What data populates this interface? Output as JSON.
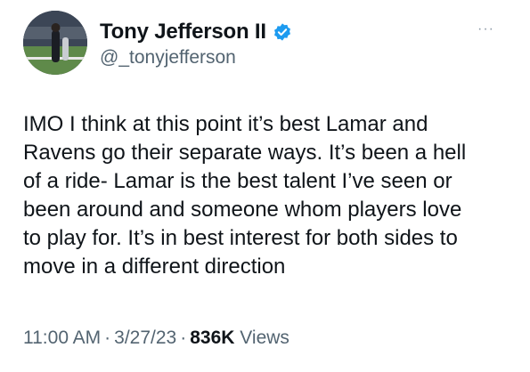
{
  "author": {
    "display_name": "Tony Jefferson II",
    "handle": "@_tonyjefferson",
    "verified": true,
    "verified_color": "#1d9bf0"
  },
  "menu": {
    "more_icon": "more-horizontal-icon",
    "more_label": "···"
  },
  "tweet": {
    "lines": [
      "IMO I think at this point it’s best Lamar and",
      "Ravens go their separate ways. It’s been a hell",
      "of a ride- Lamar is the best talent I’ve seen or",
      "been around and someone whom players love",
      "to play for. It’s in best interest for both sides to",
      "move in a different direction"
    ]
  },
  "meta": {
    "time": "11:00 AM",
    "separator": "·",
    "date": "3/27/23",
    "views_count": "836K",
    "views_label": "Views"
  }
}
